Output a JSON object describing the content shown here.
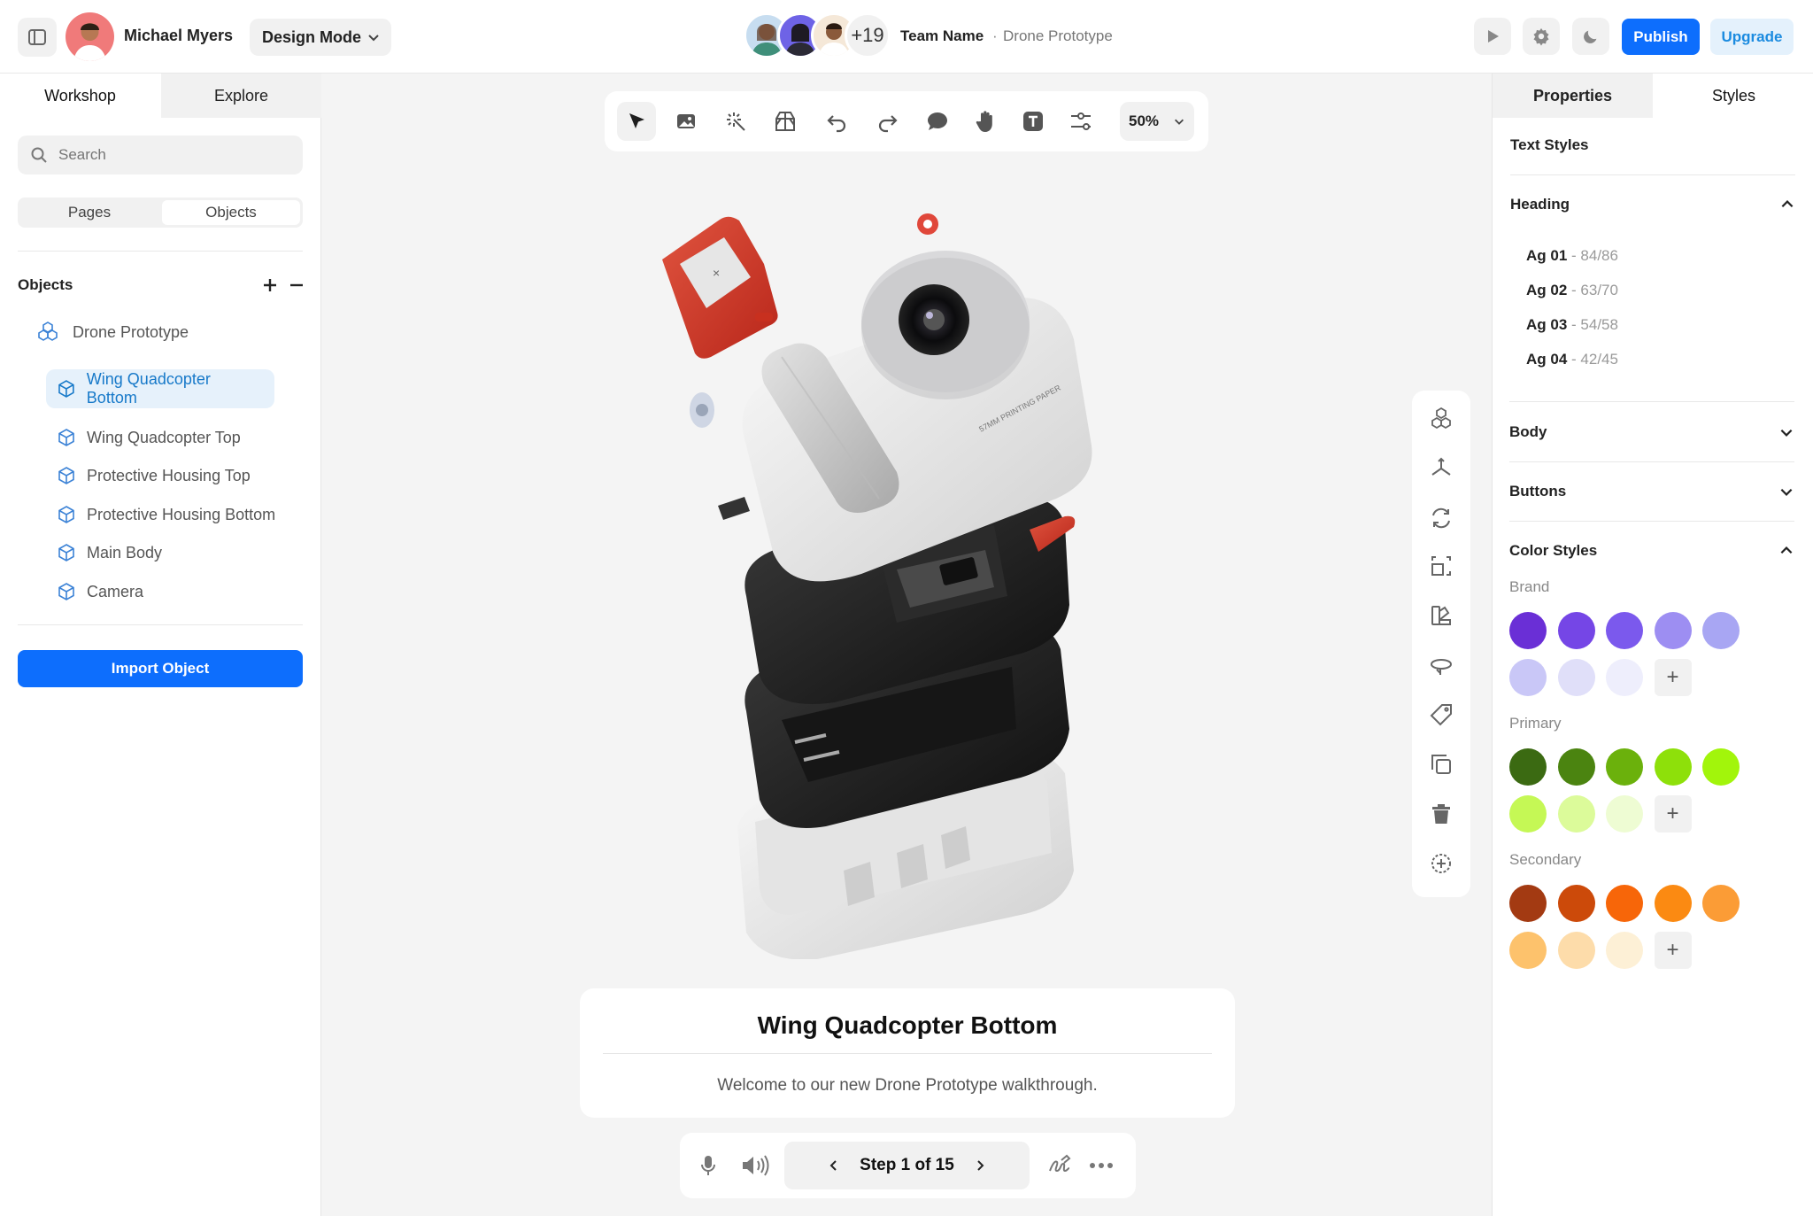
{
  "header": {
    "user_name": "Michael Myers",
    "mode_label": "Design Mode",
    "collab_count": "+19",
    "team_name": "Team Name",
    "separator": "·",
    "project_name": "Drone Prototype",
    "publish_label": "Publish",
    "upgrade_label": "Upgrade"
  },
  "left_panel": {
    "tabs": [
      "Workshop",
      "Explore"
    ],
    "search_placeholder": "Search",
    "segments": [
      "Pages",
      "Objects"
    ],
    "objects_title": "Objects",
    "root_item": "Drone Prototype",
    "items": [
      "Wing Quadcopter Bottom",
      "Wing Quadcopter Top",
      "Protective Housing Top",
      "Protective Housing Bottom",
      "Main Body",
      "Camera"
    ],
    "selected_index": 0,
    "import_label": "Import Object"
  },
  "canvas": {
    "zoom": "50%",
    "caption_title": "Wing Quadcopter Bottom",
    "caption_text": "Welcome to our new Drone Prototype walkthrough.",
    "step_label": "Step 1 of 15",
    "printed_text": "57MM PRINTING PAPER",
    "tools": [
      "pointer-icon",
      "image-icon",
      "magic-wand-icon",
      "box-icon",
      "undo-icon",
      "redo-icon",
      "comment-icon",
      "hand-icon",
      "text-icon",
      "sliders-icon"
    ],
    "side_tools": [
      "cubes-icon",
      "axis-icon",
      "rotate-icon",
      "scale-icon",
      "material-icon",
      "orbit-icon",
      "tag-icon",
      "duplicate-icon",
      "trash-icon",
      "add-point-icon"
    ]
  },
  "right_panel": {
    "tabs": [
      "Properties",
      "Styles"
    ],
    "text_styles_title": "Text Styles",
    "heading_title": "Heading",
    "heading_items": [
      {
        "name": "Ag 01",
        "value": "84/86"
      },
      {
        "name": "Ag 02",
        "value": "63/70"
      },
      {
        "name": "Ag 03",
        "value": "54/58"
      },
      {
        "name": "Ag 04",
        "value": "42/45"
      }
    ],
    "body_title": "Body",
    "buttons_title": "Buttons",
    "color_styles_title": "Color Styles",
    "brand_label": "Brand",
    "primary_label": "Primary",
    "secondary_label": "Secondary",
    "brand_colors": [
      "#6a2fd6",
      "#7546e6",
      "#7b59ed",
      "#9d8ef2",
      "#a8a6f3",
      "#c9c7f7",
      "#e0dff9",
      "#eeeefc"
    ],
    "primary_colors": [
      "#3b6a12",
      "#4b8410",
      "#6bb10c",
      "#8ee00a",
      "#a2f50b",
      "#c5f855",
      "#dcfb9a",
      "#eefcd3"
    ],
    "secondary_colors": [
      "#a33a12",
      "#cc4a0a",
      "#f76609",
      "#fb8a12",
      "#fb9c36",
      "#fdc26c",
      "#fddcaa",
      "#fdf0d6"
    ]
  },
  "colors": {
    "accent": "#0d6efd",
    "selected_bg": "#e6f1fb",
    "selected_text": "#1779c9",
    "canvas_bg": "#f4f4f4"
  }
}
